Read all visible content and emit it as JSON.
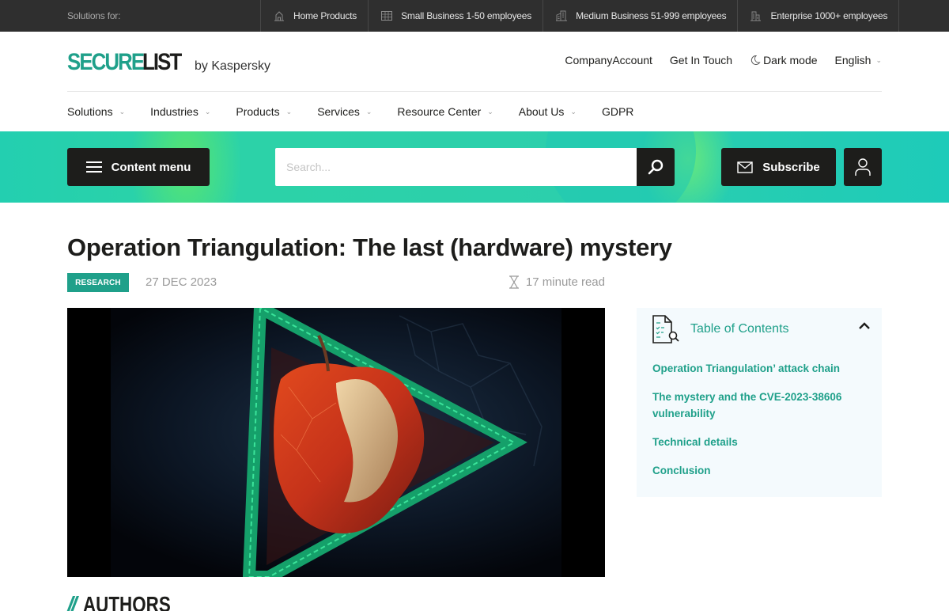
{
  "topbar": {
    "label": "Solutions for:",
    "segments": [
      {
        "label": "Home Products",
        "icon": "house-icon"
      },
      {
        "label": "Small Business 1-50 employees",
        "icon": "small-building-icon"
      },
      {
        "label": "Medium Business 51-999 employees",
        "icon": "medium-building-icon"
      },
      {
        "label": "Enterprise 1000+ employees",
        "icon": "enterprise-building-icon"
      }
    ]
  },
  "header": {
    "logo_secure": "SECURE",
    "logo_list": "LIST",
    "logo_by": "by Kaspersky",
    "links": {
      "company_account": "CompanyAccount",
      "get_in_touch": "Get In Touch",
      "dark_mode": "Dark mode",
      "language": "English"
    }
  },
  "nav": {
    "items": [
      {
        "label": "Solutions",
        "dropdown": true
      },
      {
        "label": "Industries",
        "dropdown": true
      },
      {
        "label": "Products",
        "dropdown": true
      },
      {
        "label": "Services",
        "dropdown": true
      },
      {
        "label": "Resource Center",
        "dropdown": true
      },
      {
        "label": "About Us",
        "dropdown": true
      },
      {
        "label": "GDPR",
        "dropdown": false
      }
    ]
  },
  "band": {
    "content_menu": "Content menu",
    "search_placeholder": "Search...",
    "subscribe": "Subscribe"
  },
  "article": {
    "title": "Operation Triangulation: The last (hardware) mystery",
    "tag": "RESEARCH",
    "date": "27 DEC 2023",
    "read_time": "17 minute read",
    "image_alt": "Low-poly red apple inside a green circuit-board triangle on dark background"
  },
  "toc": {
    "title": "Table of Contents",
    "items": [
      "Operation Triangulation’ attack chain",
      "The mystery and the CVE-2023-38606 vulnerability",
      "Technical details",
      "Conclusion"
    ]
  },
  "authors": {
    "slashes": "//",
    "title": "AUTHORS"
  },
  "colors": {
    "brand": "#1fa08a",
    "dark": "#1d1d1b",
    "topbar": "#2f2f2f",
    "band": "#2ccfac"
  }
}
